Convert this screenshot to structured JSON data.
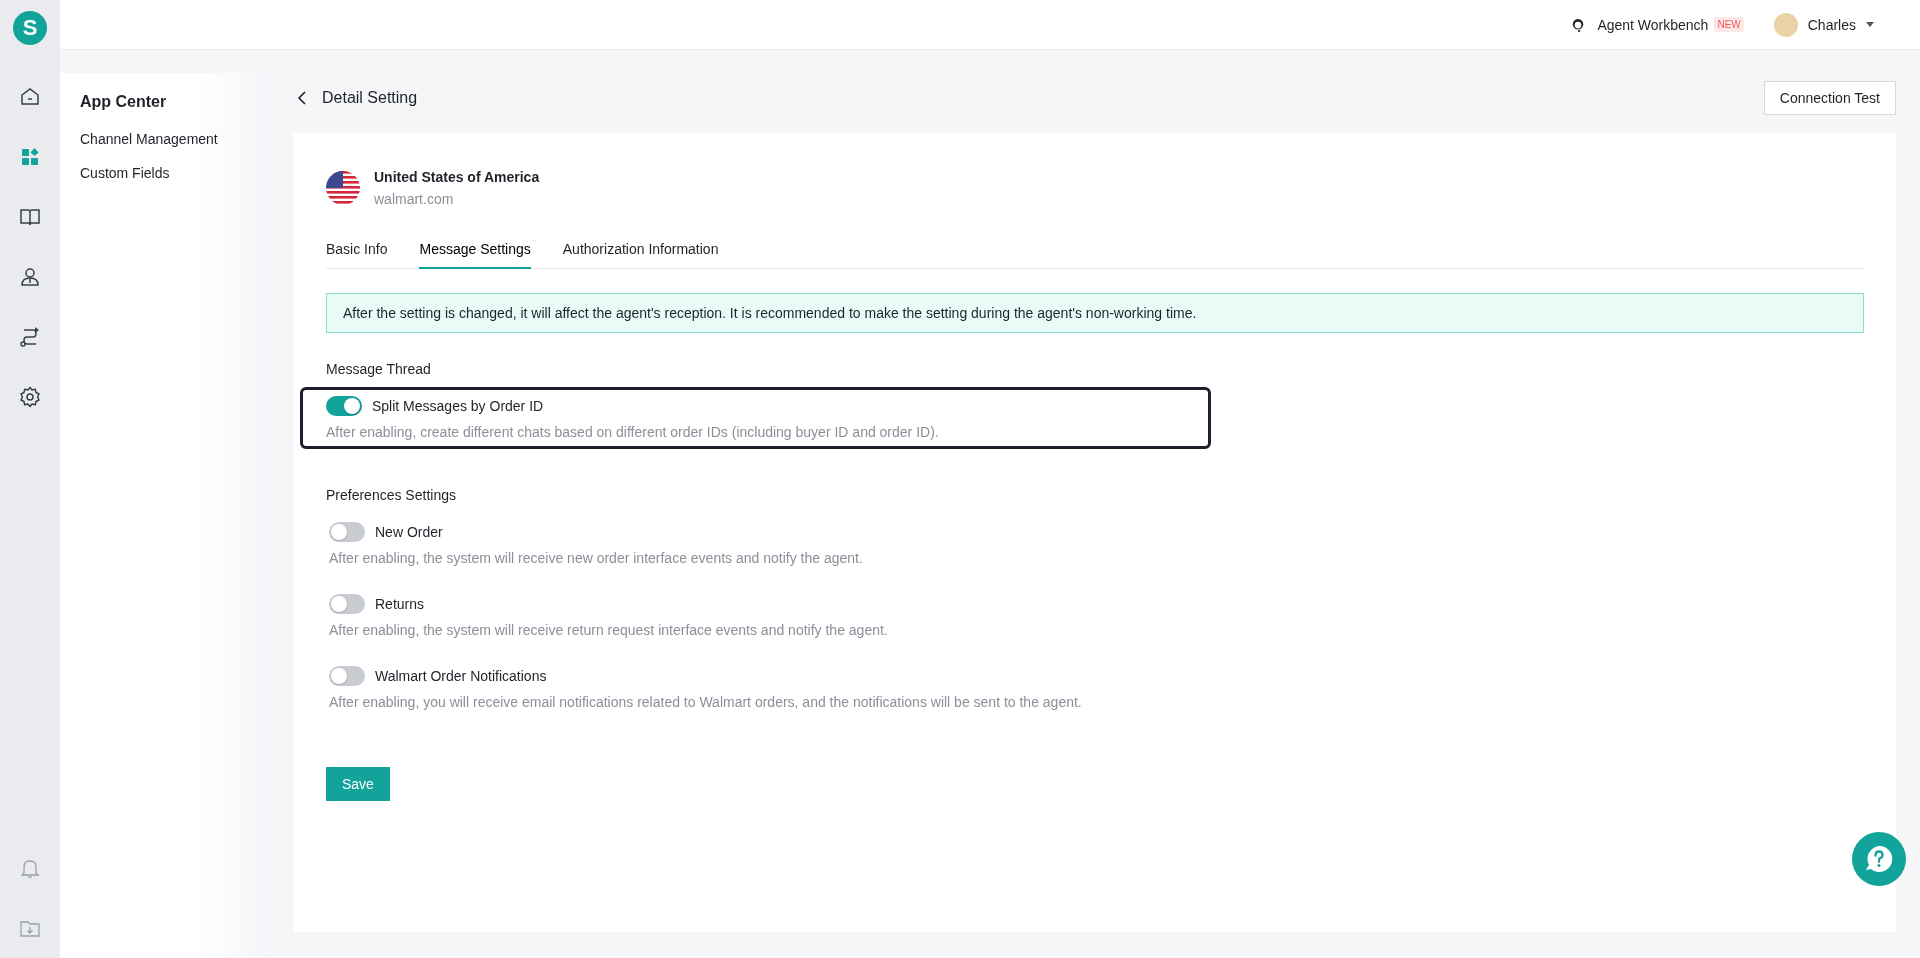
{
  "logo_letter": "S",
  "rail": [
    {
      "kind": "home",
      "selected": false
    },
    {
      "kind": "apps",
      "selected": true
    },
    {
      "kind": "book",
      "selected": false
    },
    {
      "kind": "agent",
      "selected": false
    },
    {
      "kind": "route",
      "selected": false
    },
    {
      "kind": "settings",
      "selected": false
    }
  ],
  "rail_bottom": [
    {
      "kind": "bell"
    },
    {
      "kind": "download"
    }
  ],
  "top_bar": {
    "workbench": "Agent Workbench",
    "badge": "NEW",
    "user": "Charles"
  },
  "sidebar": {
    "title": "App Center",
    "items": [
      {
        "label": "Channel Management",
        "selected": false
      },
      {
        "label": "Custom Fields",
        "selected": false
      }
    ]
  },
  "header": {
    "title": "Detail Setting",
    "button": "Connection Test"
  },
  "store": {
    "name": "United States of America",
    "domain": "walmart.com"
  },
  "tabs": [
    {
      "label": "Basic Info",
      "selected": false
    },
    {
      "label": "Message Settings",
      "selected": true
    },
    {
      "label": "Authorization Information",
      "selected": false
    }
  ],
  "alert": "After the setting is changed, it will affect the agent's reception. It is recommended to make the setting during the agent's non-working time.",
  "sections": [
    {
      "title": "Message Thread",
      "options": [
        {
          "label": "Split Messages by Order ID",
          "description": "After enabling, create different chats based on different order IDs (including buyer ID and order ID).",
          "on": true,
          "highlighted": true
        }
      ]
    },
    {
      "title": "Preferences Settings",
      "options": [
        {
          "label": "New Order",
          "description": "After enabling, the system will receive new order interface events and notify the agent.",
          "on": false,
          "highlighted": false
        },
        {
          "label": "Returns",
          "description": "After enabling, the system will receive return request interface events and notify the agent.",
          "on": false,
          "highlighted": false
        },
        {
          "label": "Walmart Order Notifications",
          "description": "After enabling, you will receive email notifications related to Walmart orders, and the notifications will be sent to the agent.",
          "on": false,
          "highlighted": false
        }
      ]
    }
  ],
  "save": "Save"
}
